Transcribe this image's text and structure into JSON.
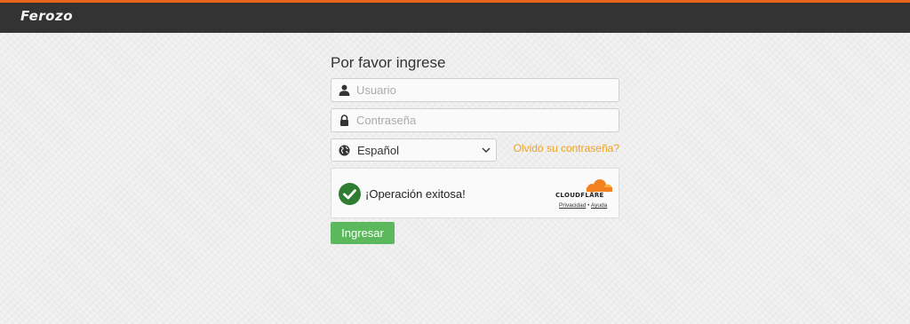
{
  "header": {
    "logo_text": "Ferozo"
  },
  "login": {
    "title": "Por favor ingrese",
    "username": {
      "placeholder": "Usuario",
      "icon": "user-icon"
    },
    "password": {
      "placeholder": "Contraseña",
      "icon": "lock-icon"
    },
    "language": {
      "selected": "Español",
      "icon": "globe-icon"
    },
    "forgot_link": "Olvidó su contraseña?",
    "captcha": {
      "status": "¡Operación exitosa!",
      "brand": "CLOUDFLARE",
      "privacy_link": "Privacidad",
      "separator": "•",
      "help_link": "Ayuda"
    },
    "submit_label": "Ingresar"
  },
  "colors": {
    "header_bg": "#333333",
    "header_accent": "#e8641b",
    "link": "#f0a020",
    "submit": "#5cb85c",
    "success": "#2e7d32",
    "cloudflare": "#f48120"
  }
}
